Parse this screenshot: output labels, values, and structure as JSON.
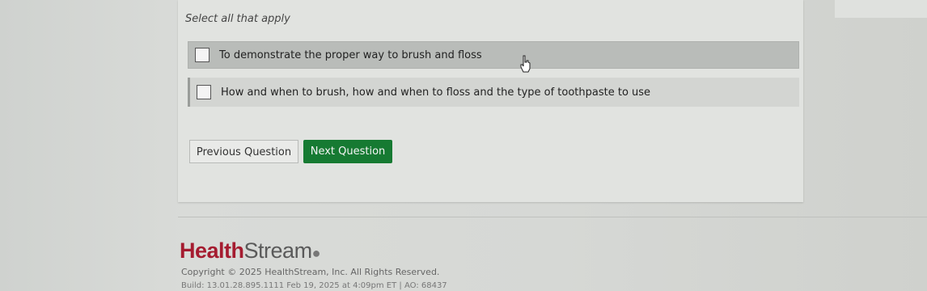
{
  "question": {
    "prompt": "Select all that apply",
    "options": [
      {
        "label": "To demonstrate the proper way to brush and floss",
        "checked": false
      },
      {
        "label": "How and when to brush, how and when to floss and the type of toothpaste to use",
        "checked": false
      }
    ]
  },
  "nav": {
    "prev_label": "Previous Question",
    "next_label": "Next Question"
  },
  "footer": {
    "brand_health": "Health",
    "brand_stream": "Stream",
    "copyright": "Copyright © 2025 HealthStream, Inc. All Rights Reserved.",
    "build": "Build: 13.01.28.895.1111 Feb 19, 2025 at 4:09pm ET | AO: 68437"
  },
  "colors": {
    "accent": "#167a32",
    "brand": "#a51c30"
  }
}
